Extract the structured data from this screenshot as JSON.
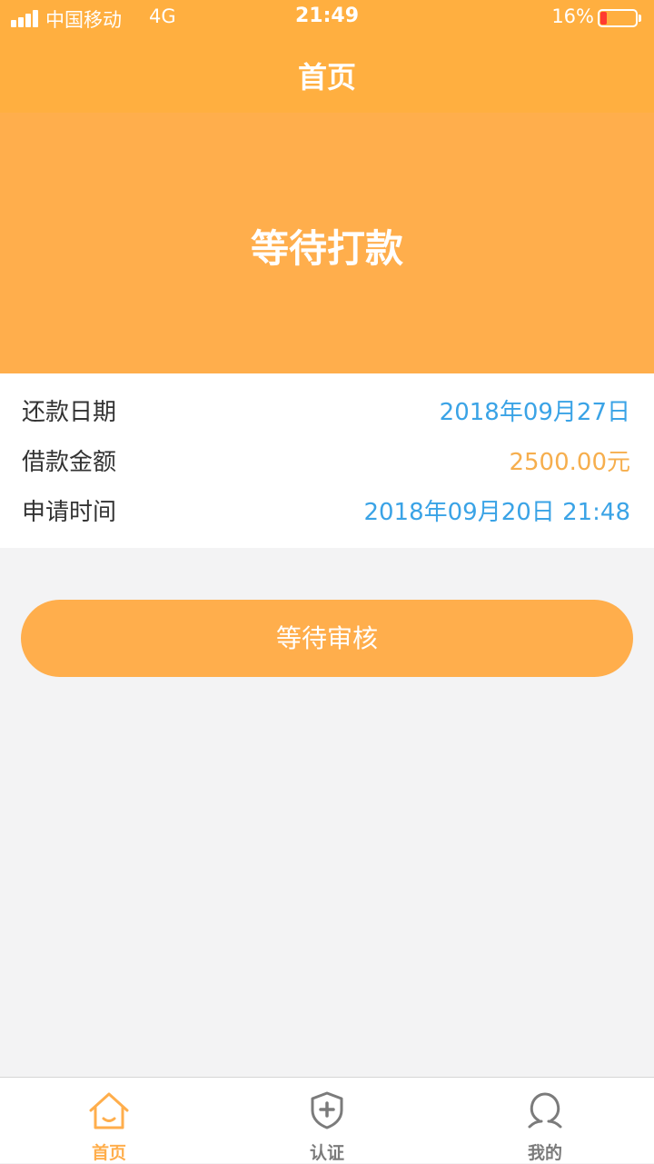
{
  "status_bar": {
    "carrier": "中国移动",
    "network": "4G",
    "time": "21:49",
    "battery": "16%"
  },
  "nav": {
    "title": "首页"
  },
  "hero": {
    "status_text": "等待打款"
  },
  "info": {
    "rows": [
      {
        "label": "还款日期",
        "value": "2018年09月27日",
        "color": "#3aa3e6"
      },
      {
        "label": "借款金额",
        "value": "2500.00元",
        "color": "#f6ae4d"
      },
      {
        "label": "申请时间",
        "value": "2018年09月20日 21:48",
        "color": "#3aa3e6"
      }
    ]
  },
  "action": {
    "label": "等待审核"
  },
  "tabbar": {
    "tabs": [
      {
        "label": "首页",
        "icon": "home-icon",
        "active": true
      },
      {
        "label": "认证",
        "icon": "shield-plus-icon",
        "active": false
      },
      {
        "label": "我的",
        "icon": "user-icon",
        "active": false
      }
    ]
  },
  "colors": {
    "accent": "#ffae4c",
    "link_blue": "#3aa3e6",
    "inactive_tab": "#7b7b7b"
  }
}
